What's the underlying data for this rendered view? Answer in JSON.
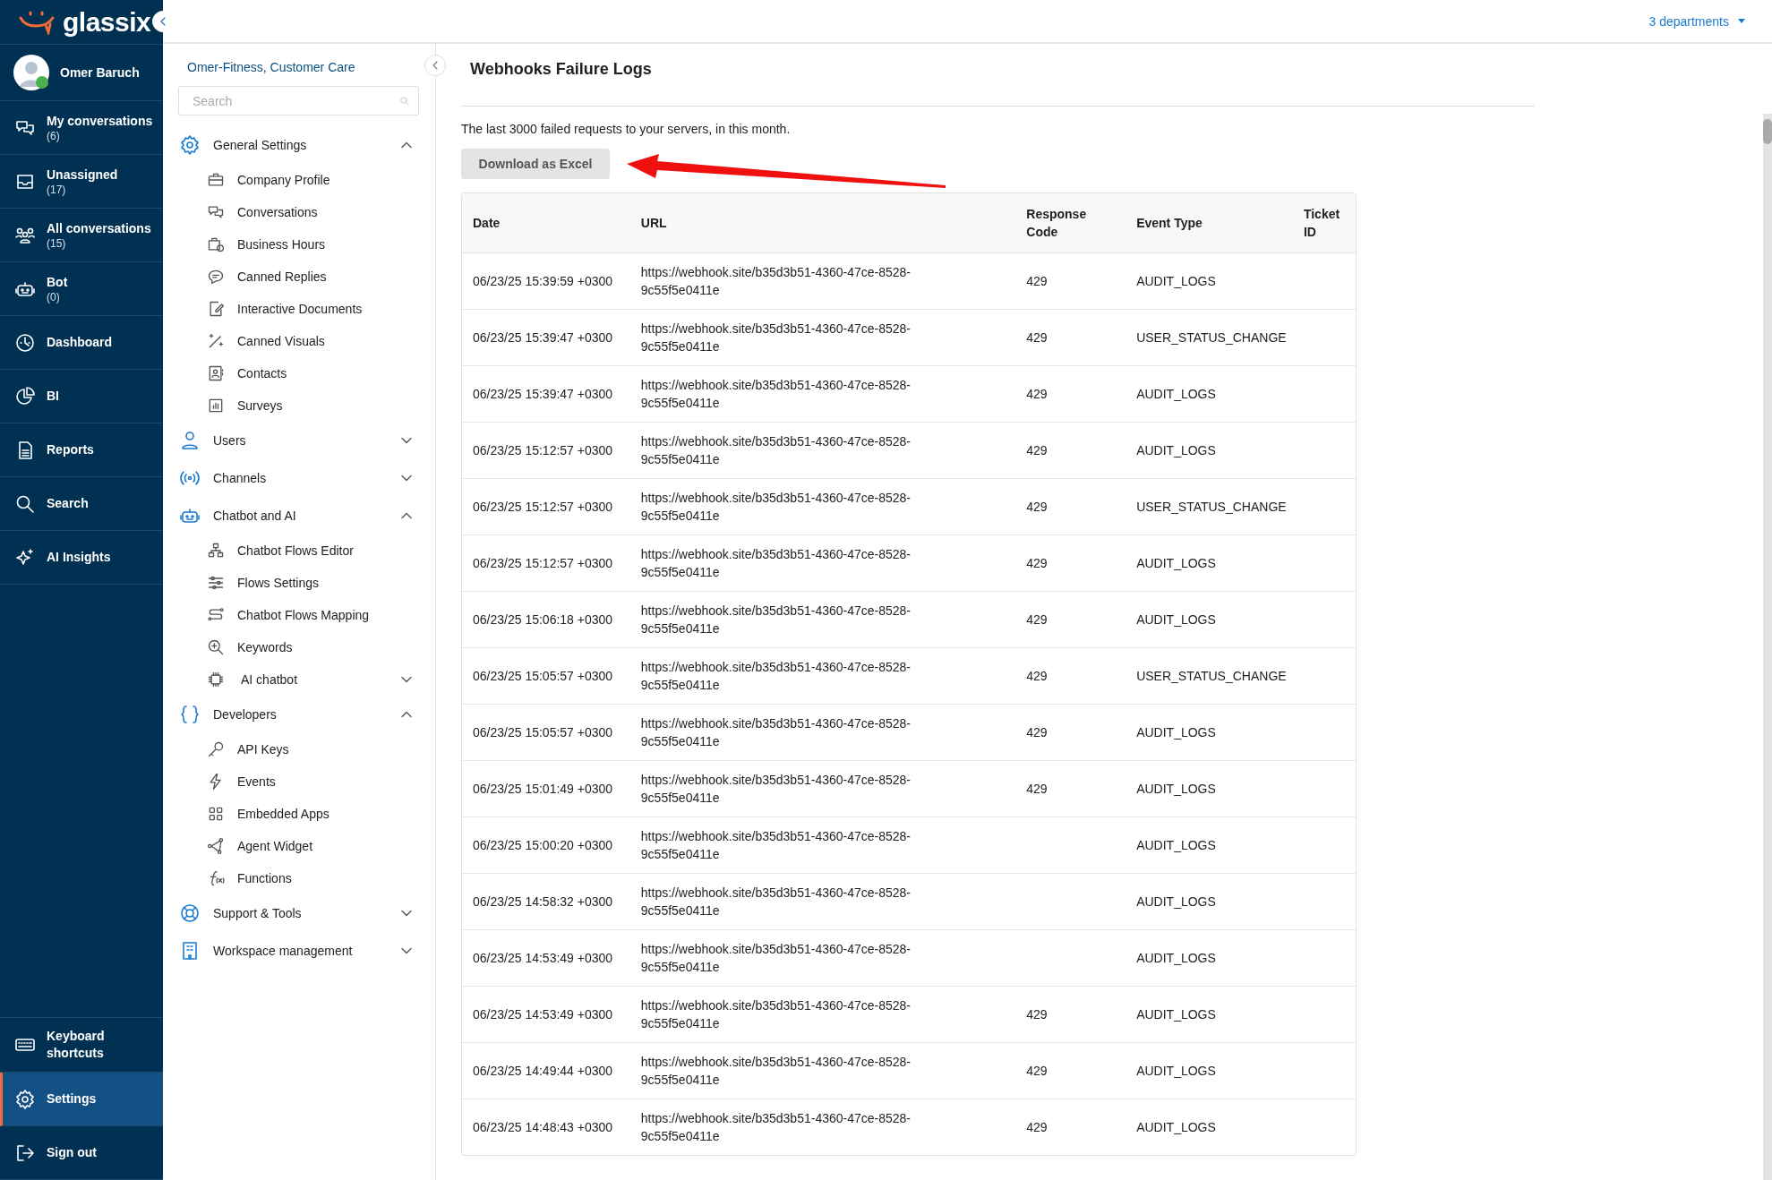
{
  "brand": {
    "name": "glassix"
  },
  "user": {
    "name": "Omer Baruch",
    "online": true
  },
  "nav": [
    {
      "label": "My conversations",
      "count": "(6)",
      "selected": false
    },
    {
      "label": "Unassigned",
      "count": "(17)",
      "selected": false
    },
    {
      "label": "All conversations",
      "count": "(15)",
      "selected": false
    },
    {
      "label": "Bot",
      "count": "(0)",
      "selected": false
    },
    {
      "label": "Dashboard",
      "selected": false
    },
    {
      "label": "BI",
      "selected": false
    },
    {
      "label": "Reports",
      "selected": false
    },
    {
      "label": "Search",
      "selected": false
    },
    {
      "label": "AI Insights",
      "selected": false
    }
  ],
  "nav_bottom": [
    {
      "label": "Keyboard shortcuts",
      "selected": false
    },
    {
      "label": "Settings",
      "selected": true
    },
    {
      "label": "Sign out",
      "selected": false
    }
  ],
  "header": {
    "departments": "3 departments"
  },
  "settings_panel": {
    "account": "Omer-Fitness, Customer Care",
    "search": {
      "placeholder": "Search"
    },
    "groups": [
      {
        "label": "General Settings",
        "expanded": true,
        "children": [
          {
            "label": "Company Profile",
            "kind": "link"
          },
          {
            "label": "Conversations",
            "kind": "link"
          },
          {
            "label": "Business Hours",
            "kind": "link"
          },
          {
            "label": "Canned Replies",
            "kind": "link"
          },
          {
            "label": "Interactive Documents",
            "kind": "link"
          },
          {
            "label": "Canned Visuals",
            "kind": "link"
          },
          {
            "label": "Contacts",
            "kind": "link"
          },
          {
            "label": "Surveys",
            "kind": "link"
          }
        ]
      },
      {
        "label": "Users",
        "expanded": false
      },
      {
        "label": "Channels",
        "expanded": false
      },
      {
        "label": "Chatbot and AI",
        "expanded": true,
        "children": [
          {
            "label": "Chatbot Flows Editor",
            "kind": "link"
          },
          {
            "label": "Flows Settings",
            "kind": "link"
          },
          {
            "label": "Chatbot Flows Mapping",
            "kind": "link"
          },
          {
            "label": "Keywords",
            "kind": "link"
          },
          {
            "label": "AI chatbot",
            "kind": "submenu",
            "expanded": false
          }
        ]
      },
      {
        "label": "Developers",
        "expanded": true,
        "children": [
          {
            "label": "API Keys",
            "kind": "link"
          },
          {
            "label": "Events",
            "kind": "link"
          },
          {
            "label": "Embedded Apps",
            "kind": "link"
          },
          {
            "label": "Agent Widget",
            "kind": "link"
          },
          {
            "label": "Functions",
            "kind": "link"
          }
        ]
      },
      {
        "label": "Support & Tools",
        "expanded": false
      },
      {
        "label": "Workspace management",
        "expanded": false
      }
    ]
  },
  "page": {
    "title": "Webhooks Failure Logs",
    "description": "The last 3000 failed requests to your servers, in this month.",
    "download_button": "Download as Excel"
  },
  "table": {
    "columns": [
      "Date",
      "URL",
      "Response Code",
      "Event Type",
      "Ticket ID"
    ],
    "rows": [
      {
        "date": "06/23/25 15:39:59 +0300",
        "url": "https://webhook.site/b35d3b51-4360-47ce-8528-9c55f5e0411e",
        "code": "429",
        "event": "AUDIT_LOGS"
      },
      {
        "date": "06/23/25 15:39:47 +0300",
        "url": "https://webhook.site/b35d3b51-4360-47ce-8528-9c55f5e0411e",
        "code": "429",
        "event": "USER_STATUS_CHANGE"
      },
      {
        "date": "06/23/25 15:39:47 +0300",
        "url": "https://webhook.site/b35d3b51-4360-47ce-8528-9c55f5e0411e",
        "code": "429",
        "event": "AUDIT_LOGS"
      },
      {
        "date": "06/23/25 15:12:57 +0300",
        "url": "https://webhook.site/b35d3b51-4360-47ce-8528-9c55f5e0411e",
        "code": "429",
        "event": "AUDIT_LOGS"
      },
      {
        "date": "06/23/25 15:12:57 +0300",
        "url": "https://webhook.site/b35d3b51-4360-47ce-8528-9c55f5e0411e",
        "code": "429",
        "event": "USER_STATUS_CHANGE"
      },
      {
        "date": "06/23/25 15:12:57 +0300",
        "url": "https://webhook.site/b35d3b51-4360-47ce-8528-9c55f5e0411e",
        "code": "429",
        "event": "AUDIT_LOGS"
      },
      {
        "date": "06/23/25 15:06:18 +0300",
        "url": "https://webhook.site/b35d3b51-4360-47ce-8528-9c55f5e0411e",
        "code": "429",
        "event": "AUDIT_LOGS"
      },
      {
        "date": "06/23/25 15:05:57 +0300",
        "url": "https://webhook.site/b35d3b51-4360-47ce-8528-9c55f5e0411e",
        "code": "429",
        "event": "USER_STATUS_CHANGE"
      },
      {
        "date": "06/23/25 15:05:57 +0300",
        "url": "https://webhook.site/b35d3b51-4360-47ce-8528-9c55f5e0411e",
        "code": "429",
        "event": "AUDIT_LOGS"
      },
      {
        "date": "06/23/25 15:01:49 +0300",
        "url": "https://webhook.site/b35d3b51-4360-47ce-8528-9c55f5e0411e",
        "code": "429",
        "event": "AUDIT_LOGS"
      },
      {
        "date": "06/23/25 15:00:20 +0300",
        "url": "https://webhook.site/b35d3b51-4360-47ce-8528-9c55f5e0411e",
        "event": "AUDIT_LOGS"
      },
      {
        "date": "06/23/25 14:58:32 +0300",
        "url": "https://webhook.site/b35d3b51-4360-47ce-8528-9c55f5e0411e",
        "event": "AUDIT_LOGS"
      },
      {
        "date": "06/23/25 14:53:49 +0300",
        "url": "https://webhook.site/b35d3b51-4360-47ce-8528-9c55f5e0411e",
        "event": "AUDIT_LOGS"
      },
      {
        "date": "06/23/25 14:53:49 +0300",
        "url": "https://webhook.site/b35d3b51-4360-47ce-8528-9c55f5e0411e",
        "code": "429",
        "event": "AUDIT_LOGS"
      },
      {
        "date": "06/23/25 14:49:44 +0300",
        "url": "https://webhook.site/b35d3b51-4360-47ce-8528-9c55f5e0411e",
        "code": "429",
        "event": "AUDIT_LOGS"
      },
      {
        "date": "06/23/25 14:48:43 +0300",
        "url": "https://webhook.site/b35d3b51-4360-47ce-8528-9c55f5e0411e",
        "code": "429",
        "event": "AUDIT_LOGS"
      }
    ]
  }
}
